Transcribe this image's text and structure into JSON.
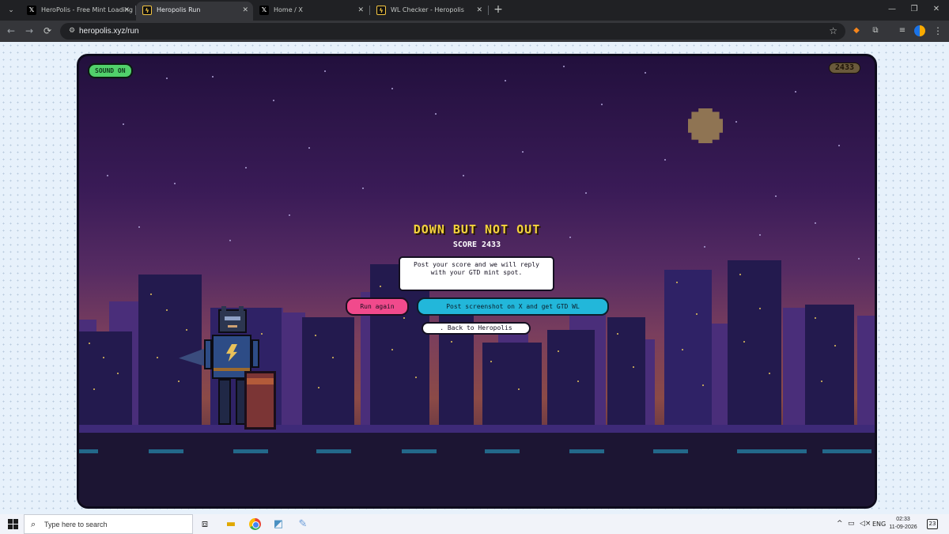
{
  "browser": {
    "tabs": [
      {
        "title": "HeroPolis - Free Mint Loading |",
        "favicon": "x-icon",
        "active": false
      },
      {
        "title": "Heropolis Run",
        "favicon": "heropolis-icon",
        "active": true
      },
      {
        "title": "Home / X",
        "favicon": "x-icon",
        "active": false
      },
      {
        "title": "WL Checker - Heropolis",
        "favicon": "heropolis-icon",
        "active": false
      }
    ],
    "url": "heropolis.xyz/run"
  },
  "game": {
    "sound_label": "SOUND ON",
    "score_badge": "2433",
    "title": "DOWN BUT NOT OUT",
    "score_text": "SCORE 2433",
    "message": "Post your score and we will reply with your GTD mint spot.",
    "run_again_label": "Run again",
    "post_label": "Post screenshot on X and get GTD WL",
    "back_label": ". Back to Heropolis",
    "colors": {
      "title": "#f4d33c",
      "run_button": "#f14a8c",
      "post_button": "#22b7da",
      "sound_button": "#51d06b"
    }
  },
  "taskbar": {
    "search_placeholder": "Type here to search",
    "language": "ENG",
    "time": "02:33",
    "date": "11-09-2026",
    "notification_count": "23"
  }
}
